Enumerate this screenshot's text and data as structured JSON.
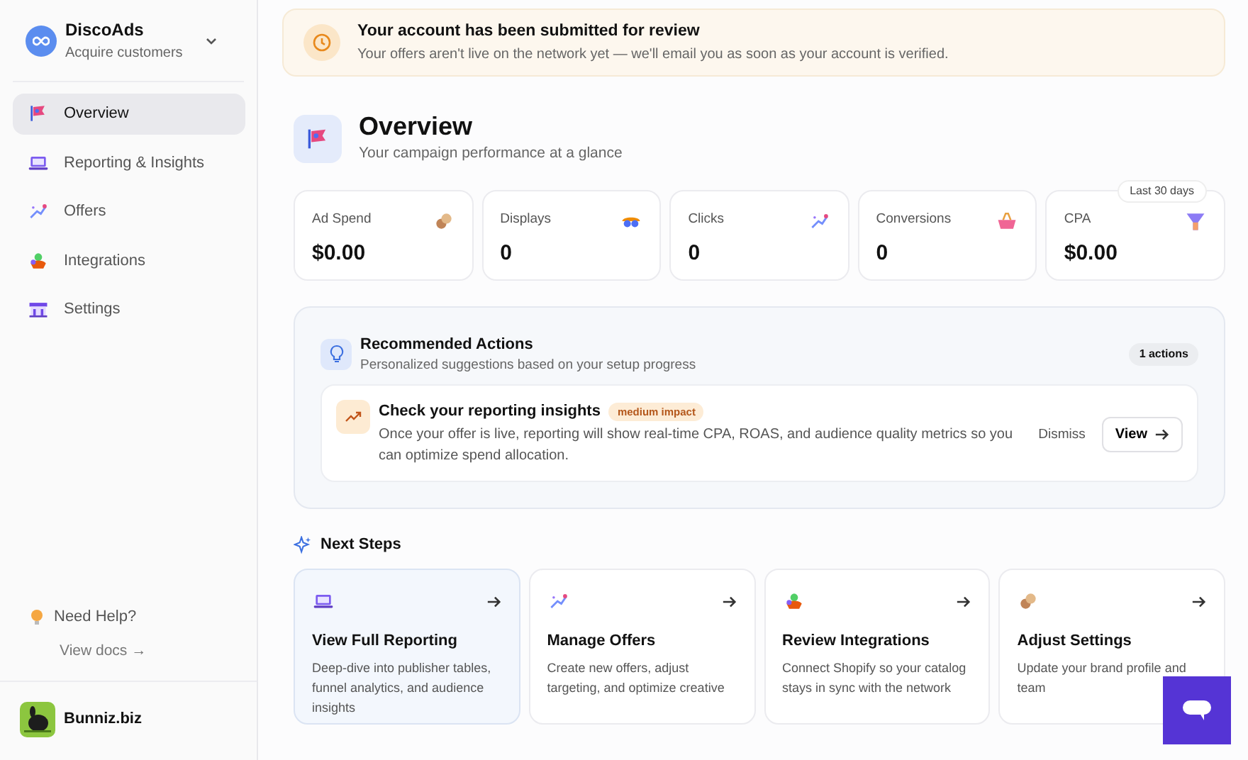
{
  "brand": {
    "name": "DiscoAds",
    "tagline": "Acquire customers"
  },
  "nav": [
    {
      "label": "Overview",
      "selected": true
    },
    {
      "label": "Reporting & Insights",
      "selected": false
    },
    {
      "label": "Offers",
      "selected": false
    },
    {
      "label": "Integrations",
      "selected": false
    },
    {
      "label": "Settings",
      "selected": false
    }
  ],
  "help": {
    "title": "Need Help?",
    "link": "View docs →"
  },
  "account": {
    "name": "Bunniz.biz"
  },
  "alert": {
    "title": "Your account has been submitted for review",
    "text": "Your offers aren't live on the network yet — we'll email you as soon as your account is verified."
  },
  "page": {
    "title": "Overview",
    "subtitle": "Your campaign performance at a glance"
  },
  "period_badge": "Last 30 days",
  "stats": [
    {
      "label": "Ad Spend",
      "value": "$0.00"
    },
    {
      "label": "Displays",
      "value": "0"
    },
    {
      "label": "Clicks",
      "value": "0"
    },
    {
      "label": "Conversions",
      "value": "0"
    },
    {
      "label": "CPA",
      "value": "$0.00"
    }
  ],
  "recommended": {
    "title": "Recommended Actions",
    "subtitle": "Personalized suggestions based on your setup progress",
    "count": "1 actions",
    "items": [
      {
        "title": "Check your reporting insights",
        "impact": "medium impact",
        "text": "Once your offer is live, reporting will show real-time CPA, ROAS, and audience quality metrics so you can optimize spend allocation.",
        "dismiss": "Dismiss",
        "action": "View"
      }
    ]
  },
  "next_steps": {
    "title": "Next Steps",
    "items": [
      {
        "title": "View Full Reporting",
        "text": "Deep-dive into publisher tables, funnel analytics, and audience insights",
        "selected": true
      },
      {
        "title": "Manage Offers",
        "text": "Create new offers, adjust targeting, and optimize creative",
        "selected": false
      },
      {
        "title": "Review Integrations",
        "text": "Connect Shopify so your catalog stays in sync with the network",
        "selected": false
      },
      {
        "title": "Adjust Settings",
        "text": "Update your brand profile and team",
        "selected": false
      }
    ]
  }
}
